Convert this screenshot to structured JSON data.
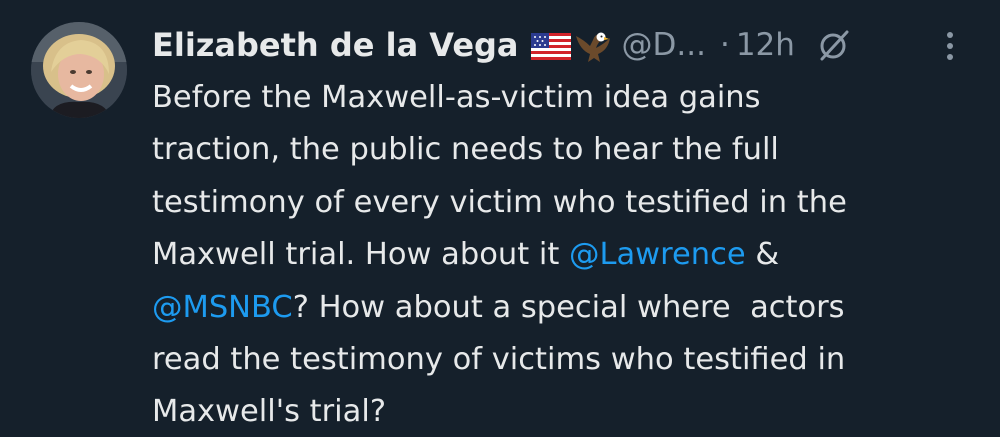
{
  "tweet": {
    "author": {
      "name": "Elizabeth de la Vega",
      "handle": "@D...",
      "emoji": [
        "us-flag-icon",
        "eagle-icon"
      ]
    },
    "separator": "·",
    "time": "12h",
    "icons": {
      "grok": "slashed-circle-icon",
      "more": "vertical-dots-icon"
    },
    "colors": {
      "background": "#15202b",
      "text": "#e7e9ea",
      "secondary": "#8b98a5",
      "link": "#1d9bf0"
    },
    "body": {
      "line1": "Before the Maxwell-as-victim idea gains",
      "line2": "traction, the public needs to hear the full",
      "line3": "testimony of every victim who testified in the",
      "line4_a": "Maxwell trial. How about it ",
      "line4_mention": "@Lawrence",
      "line4_b": " &",
      "line5_mention": "@MSNBC",
      "line5_b": "? How about a special where  actors",
      "line6": "read the testimony of victims who testified in",
      "line7": "Maxwell's trial?"
    }
  }
}
